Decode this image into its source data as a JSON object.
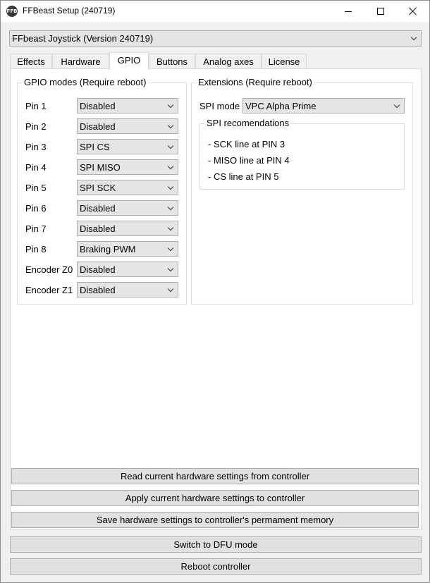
{
  "window": {
    "title": "FFBeast Setup (240719)",
    "icon_text": "FFB"
  },
  "device_select": {
    "value": "FFbeast Joystick (Version 240719)"
  },
  "tabs": [
    {
      "label": "Effects"
    },
    {
      "label": "Hardware"
    },
    {
      "label": "GPIO"
    },
    {
      "label": "Buttons"
    },
    {
      "label": "Analog axes"
    },
    {
      "label": "License"
    }
  ],
  "active_tab": "GPIO",
  "gpio": {
    "title": "GPIO modes (Require reboot)",
    "pins": [
      {
        "label": "Pin 1",
        "value": "Disabled"
      },
      {
        "label": "Pin 2",
        "value": "Disabled"
      },
      {
        "label": "Pin 3",
        "value": "SPI CS"
      },
      {
        "label": "Pin 4",
        "value": "SPI MISO"
      },
      {
        "label": "Pin 5",
        "value": "SPI SCK"
      },
      {
        "label": "Pin 6",
        "value": "Disabled"
      },
      {
        "label": "Pin 7",
        "value": "Disabled"
      },
      {
        "label": "Pin 8",
        "value": "Braking PWM"
      },
      {
        "label": "Encoder Z0",
        "value": "Disabled"
      },
      {
        "label": "Encoder Z1",
        "value": "Disabled"
      }
    ]
  },
  "extensions": {
    "title": "Extensions (Require reboot)",
    "spi_mode_label": "SPI mode",
    "spi_mode_value": "VPC Alpha Prime",
    "recommendations": {
      "title": "SPI recomendations",
      "lines": [
        "- SCK line at PIN 3",
        "- MISO line at PIN 4",
        "- CS line at PIN 5"
      ]
    }
  },
  "actions": {
    "read": "Read current hardware settings from controller",
    "apply": "Apply current hardware settings to controller",
    "save": "Save hardware settings to controller's permament memory",
    "dfu": "Switch to DFU mode",
    "reboot": "Reboot controller"
  }
}
